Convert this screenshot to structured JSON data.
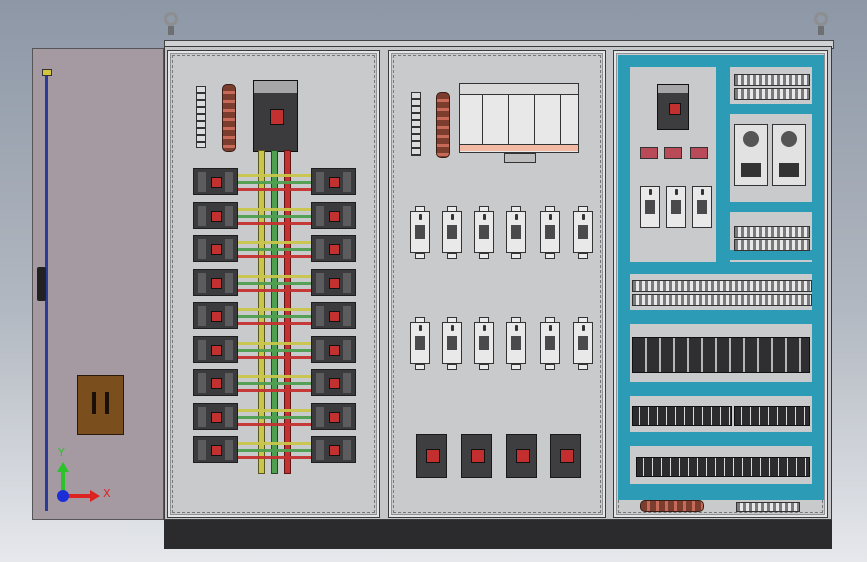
{
  "scene": {
    "colors": {
      "enclosure": "#c4c6c9",
      "door": "#a69aa2",
      "plinth": "#2b2b2e",
      "busbar_yellow": "#c9c64a",
      "busbar_green": "#4f9f50",
      "busbar_red": "#c53030",
      "wire_duct": "#2b9bb6",
      "breaker_toggle": "#c33030"
    },
    "icons": [
      "eyebolt-icon",
      "door-handle-icon",
      "triad-axis-icon"
    ]
  },
  "triad": {
    "x_label": "X",
    "y_label": "Y",
    "z_label": ""
  }
}
